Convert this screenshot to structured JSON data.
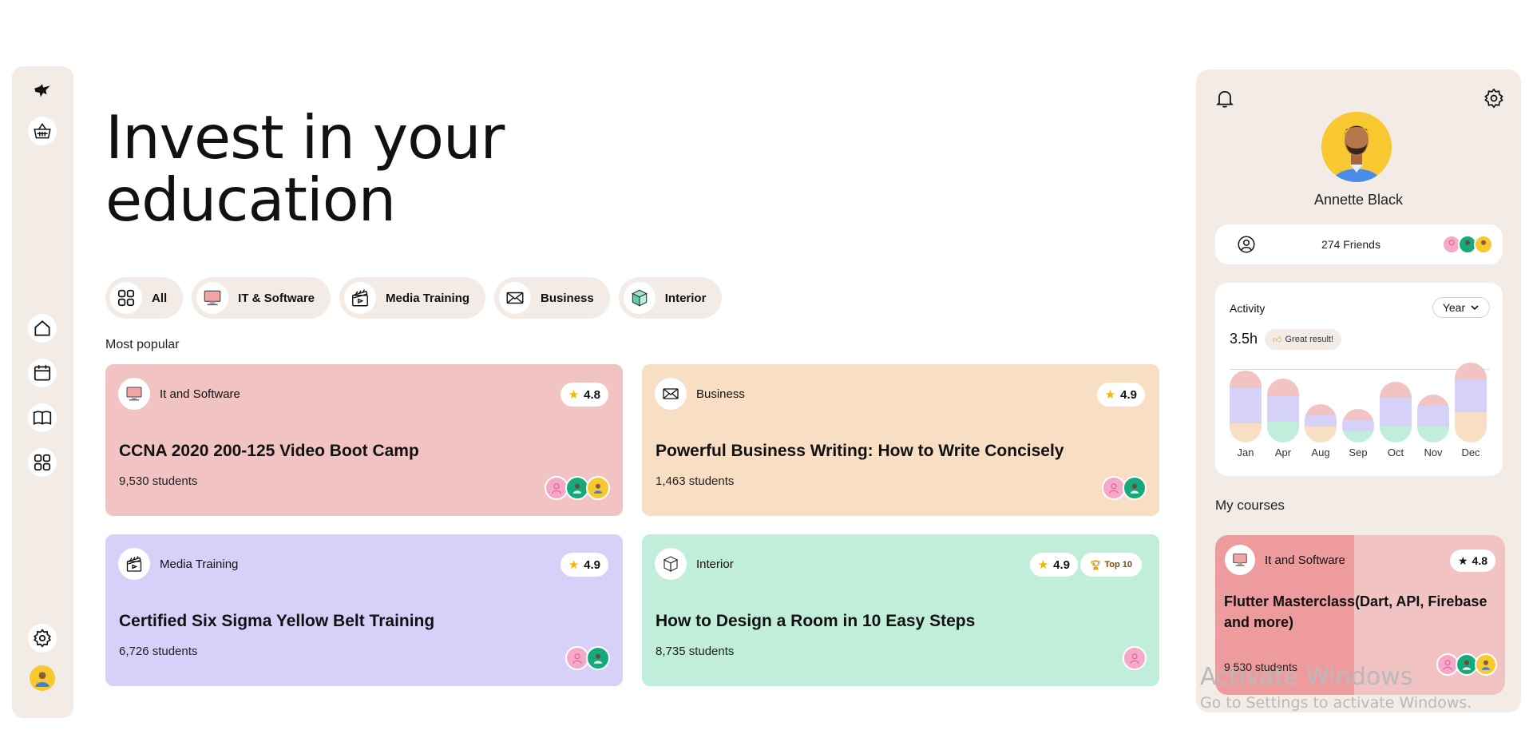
{
  "hero": {
    "line1": "Invest in your",
    "line2": "education"
  },
  "tabs": [
    {
      "label": "All",
      "icon": "grid-icon"
    },
    {
      "label": "IT & Software",
      "icon": "monitor-icon"
    },
    {
      "label": "Media Training",
      "icon": "clapperboard-icon"
    },
    {
      "label": "Business",
      "icon": "envelope-icon"
    },
    {
      "label": "Interior",
      "icon": "cube-icon"
    }
  ],
  "section": {
    "most_popular": "Most popular"
  },
  "courses": [
    {
      "category": "It and Software",
      "rating": "4.8",
      "title": "CCNA 2020 200-125 Video Boot Camp",
      "students": "9,530 students",
      "color": "#f2c3c3"
    },
    {
      "category": "Business",
      "rating": "4.9",
      "title": "Powerful Business Writing: How to Write Concisely",
      "students": "1,463 students",
      "color": "#f8dfc3"
    },
    {
      "category": "Media Training",
      "rating": "4.9",
      "title": "Certified Six Sigma Yellow Belt Training",
      "students": "6,726 students",
      "color": "#d6d1f9"
    },
    {
      "category": "Interior",
      "rating": "4.9",
      "badge": "Top 10",
      "title": "How to Design a Room in 10 Easy Steps",
      "students": "8,735 students",
      "color": "#c0eedb"
    }
  ],
  "profile": {
    "name": "Annette Black",
    "friends": "274 Friends"
  },
  "activity": {
    "title": "Activity",
    "period": "Year",
    "hours": "3.5h",
    "badge": "Great result!",
    "colors": {
      "top": "#f2c3c3",
      "mid": "#d6d1f9",
      "bottom1": "#f8dfc3",
      "bottom2": "#c0eedb"
    }
  },
  "chart_data": {
    "type": "bar",
    "categories": [
      "Jan",
      "Apr",
      "Aug",
      "Sep",
      "Oct",
      "Nov",
      "Dec"
    ],
    "series": [
      {
        "values": [
          22,
          22,
          14,
          14,
          20,
          14,
          22
        ]
      },
      {
        "values": [
          44,
          32,
          14,
          14,
          36,
          26,
          40
        ]
      },
      {
        "values": [
          24,
          26,
          20,
          14,
          20,
          20,
          38
        ]
      }
    ]
  },
  "my_courses": {
    "title": "My courses",
    "course": {
      "category": "It and Software",
      "rating": "4.8",
      "title": "Flutter Masterclass(Dart, API, Firebase and more)",
      "students": "9,530 students",
      "progress": 0.48
    }
  },
  "watermark": {
    "line1": "Activate Windows",
    "line2": "Go to Settings to activate Windows."
  }
}
